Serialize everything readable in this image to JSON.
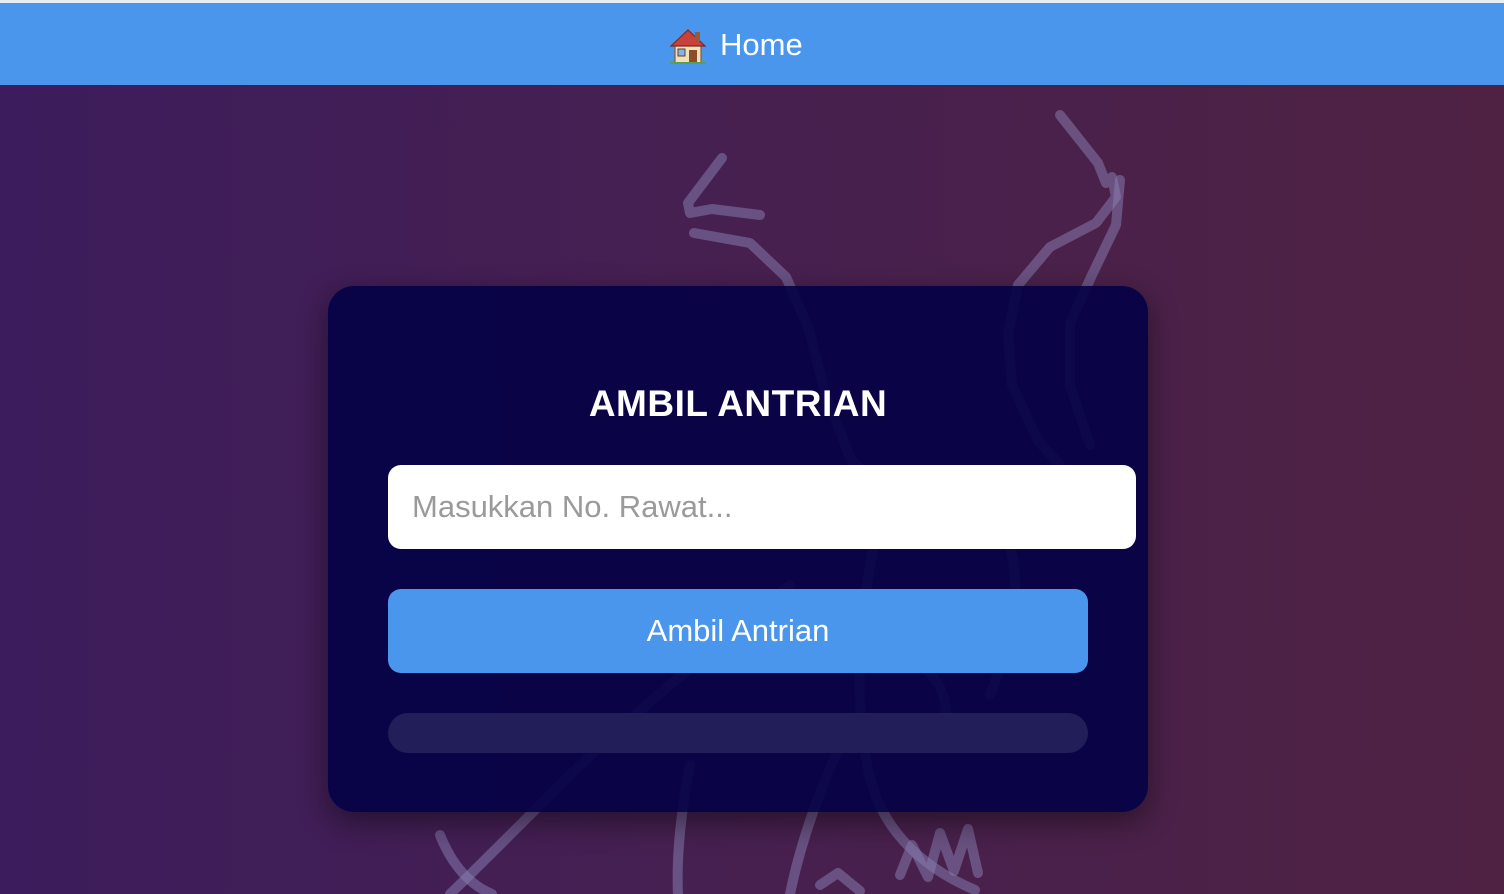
{
  "navbar": {
    "home_icon": "house-emoji-icon",
    "home_label": "Home",
    "background_color": "#4a96ed"
  },
  "background": {
    "gradient_colors": [
      "#3c1c5c",
      "#4f2243"
    ],
    "watermark": "deer-outline-illustration"
  },
  "card": {
    "title": "AMBIL ANTRIAN",
    "input": {
      "value": "",
      "placeholder": "Masukkan No. Rawat..."
    },
    "submit_label": "Ambil Antrian",
    "result_text": "",
    "background_color": "#050246",
    "button_color": "#4a96ed"
  }
}
